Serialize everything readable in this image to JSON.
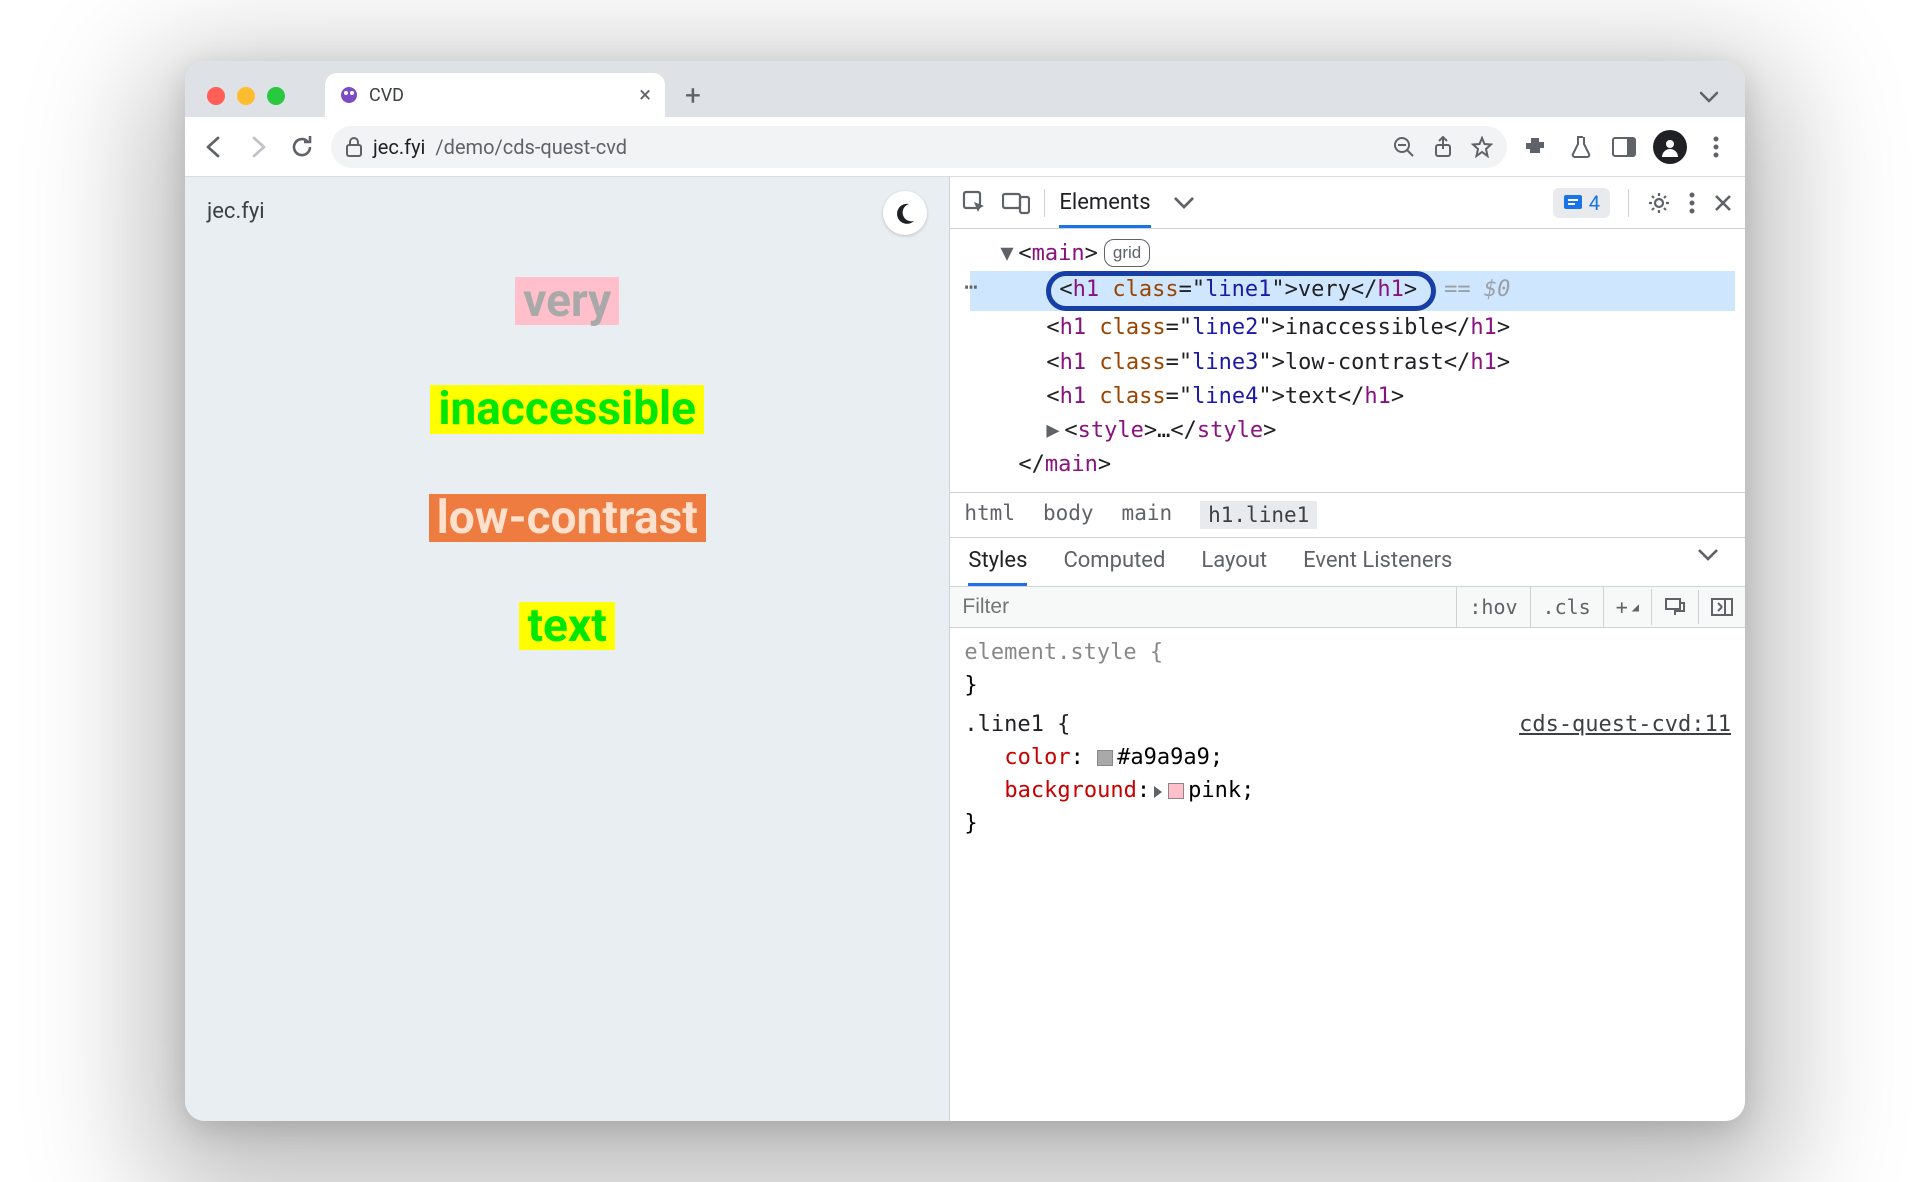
{
  "tab": {
    "title": "CVD",
    "favicon_color": "#7b4bc4"
  },
  "omnibox": {
    "domain": "jec.fyi",
    "path": "/demo/cds-quest-cvd"
  },
  "page": {
    "brand": "jec.fyi",
    "lines": {
      "l1": "very",
      "l2": "inaccessible",
      "l3": "low-contrast",
      "l4": "text"
    }
  },
  "devtools": {
    "tabs": {
      "elements": "Elements"
    },
    "issues_count": "4",
    "tree": {
      "main_open": "main",
      "grid_badge": "grid",
      "h1_tag": "h1",
      "class_attr": "class",
      "line1_cls": "line1",
      "line1_txt": "very",
      "line2_cls": "line2",
      "line2_txt": "inaccessible",
      "line3_cls": "line3",
      "line3_txt": "low-contrast",
      "line4_cls": "line4",
      "line4_txt": "text",
      "style_tag": "style",
      "style_ell": "…",
      "main_close": "main",
      "eq0": "== $0"
    },
    "crumb": {
      "html": "html",
      "body": "body",
      "main": "main",
      "sel": "h1.line1"
    },
    "styles_tabs": {
      "styles": "Styles",
      "computed": "Computed",
      "layout": "Layout",
      "events": "Event Listeners"
    },
    "filter_placeholder": "Filter",
    "hov": ":hov",
    "cls": ".cls",
    "rules": {
      "element_style": "element.style {",
      "close_brace": "}",
      "line1_sel": ".line1 {",
      "src": "cds-quest-cvd:11",
      "color_prop": "color",
      "color_val": "#a9a9a9",
      "bg_prop": "background",
      "bg_val": "pink"
    }
  }
}
